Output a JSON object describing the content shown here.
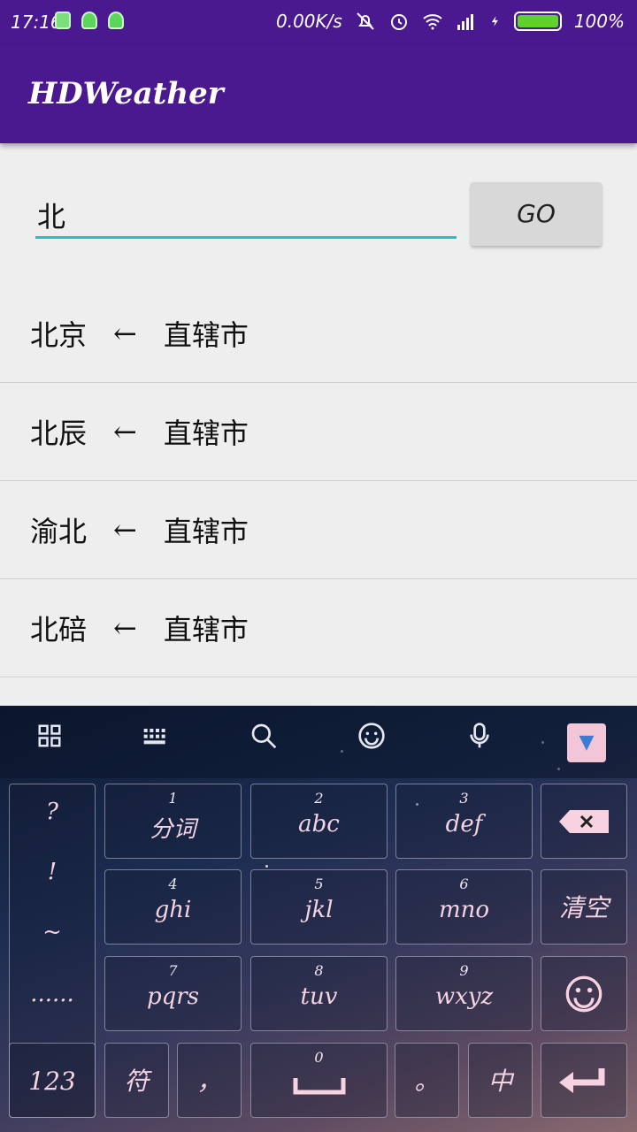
{
  "status_bar": {
    "time": "17:16",
    "net_speed": "0.00K/s",
    "battery_percent": "100%"
  },
  "app_bar": {
    "title": "HDWeather"
  },
  "search": {
    "value": "北",
    "go_label": "GO"
  },
  "results": [
    {
      "city": "北京",
      "arrow": "←",
      "region": "直辖市"
    },
    {
      "city": "北辰",
      "arrow": "←",
      "region": "直辖市"
    },
    {
      "city": "渝北",
      "arrow": "←",
      "region": "直辖市"
    },
    {
      "city": "北碚",
      "arrow": "←",
      "region": "直辖市"
    }
  ],
  "keyboard": {
    "left_symbols": [
      "?",
      "!",
      "~",
      "......"
    ],
    "keys": [
      {
        "num": "1",
        "label": "分词"
      },
      {
        "num": "2",
        "label": "abc"
      },
      {
        "num": "3",
        "label": "def"
      },
      {
        "num": "4",
        "label": "ghi"
      },
      {
        "num": "5",
        "label": "jkl"
      },
      {
        "num": "6",
        "label": "mno"
      },
      {
        "num": "7",
        "label": "pqrs"
      },
      {
        "num": "8",
        "label": "tuv"
      },
      {
        "num": "9",
        "label": "wxyz"
      }
    ],
    "clear_label": "清空",
    "bottom": {
      "k123": "123",
      "symbols": "符",
      "comma": "，",
      "space_num": "0",
      "period": "。",
      "lang": "中"
    }
  },
  "colors": {
    "primary": "#4a1990",
    "accent": "#1ec4c6"
  }
}
